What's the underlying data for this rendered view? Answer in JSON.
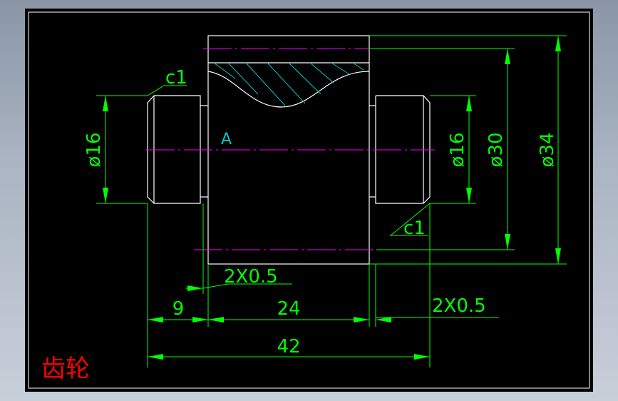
{
  "title": "齿轮",
  "labels": {
    "section": "A",
    "chamfer_left": "c1",
    "chamfer_right": "c1",
    "dia_left": "ø16",
    "dia_right": "ø16",
    "dia_mid": "ø30",
    "dia_outer": "ø34",
    "groove_left": "2X0.5",
    "groove_right": "2X0.5",
    "len_left": "9",
    "len_mid": "24",
    "len_total": "42"
  },
  "colors": {
    "background": "#000000",
    "outline": "#ffffff",
    "dimension": "#00ff00",
    "centerline": "#ff00ff",
    "hatch": "#00c8c8",
    "title": "#ff0000"
  }
}
